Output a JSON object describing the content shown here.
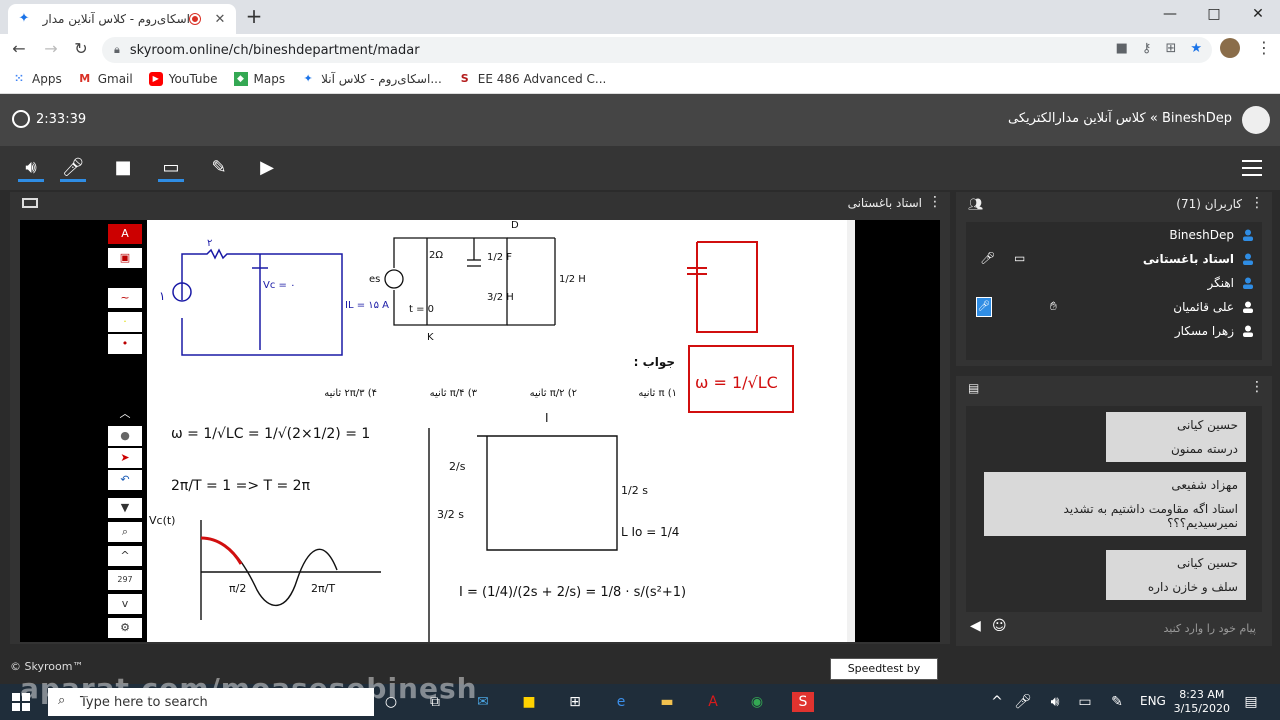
{
  "browser": {
    "tab_title": "اسکای‌روم - کلاس آنلاین مدار ال",
    "new_tab": "+",
    "url": "skyroom.online/ch/bineshdepartment/madar",
    "window_controls": [
      "—",
      "□",
      "✕"
    ]
  },
  "bookmarks": [
    {
      "label": "Apps",
      "icon": "apps-grid-icon"
    },
    {
      "label": "Gmail",
      "icon": "gmail-icon"
    },
    {
      "label": "YouTube",
      "icon": "youtube-icon"
    },
    {
      "label": "Maps",
      "icon": "maps-icon"
    },
    {
      "label": "اسکای‌روم - کلاس آنلا...",
      "icon": "skyroom-icon"
    },
    {
      "label": "EE 486 Advanced C...",
      "icon": "s-logo-icon"
    }
  ],
  "app": {
    "timer": "2:33:39",
    "room_title": "BineshDep » کلاس آنلاین مدارالکتریکی"
  },
  "main_panel": {
    "title": "استاد باغستانی"
  },
  "whiteboard": {
    "answer_label": "جواب :",
    "options": [
      "۱) π ثانیه",
      "۲) π/۲ ثانیه",
      "۳) π/۴ ثانیه",
      "۴) ۲π/۳ ثانیه"
    ],
    "labels": {
      "r2": "۲",
      "src1": "۱",
      "vc": "Vc = ۰",
      "il": "IL = ۱۵ A",
      "d": "D",
      "ohm2": "2Ω",
      "c_half": "1/2 F",
      "l_half": "1/2 H",
      "l_32": "3/2 H",
      "es": "es",
      "t0": "t = 0",
      "k": "K",
      "omega_boxed": "ω = 1/√LC",
      "omega_eq": "ω = 1/√LC = 1/√(2×1/2) = 1",
      "period_eq": "2π/T = 1 => T = 2π",
      "vc_axis": "Vc(t)",
      "pi2": "π/2",
      "t_over_2": "2π/T",
      "i_label": "I",
      "two_s": "2/s",
      "half_s": "1/2 s",
      "three_half_s": "3/2 s",
      "lio": "L Io = 1/4",
      "i_eq": "I = (1/4)/(2s + 2/s) = 1/8 · s/(s²+1)"
    }
  },
  "users": {
    "header": "کاربران (71)",
    "items": [
      {
        "name": "BineshDep",
        "bold": false
      },
      {
        "name": "استاد باغستانی",
        "bold": true
      },
      {
        "name": "اهنگر",
        "bold": false
      },
      {
        "name": "علی قائمیان",
        "bold": false
      },
      {
        "name": "زهرا مسکار",
        "bold": false
      }
    ]
  },
  "chat": {
    "messages": [
      {
        "author": "حسین کیانی",
        "text": "درسته ممنون"
      },
      {
        "author": "مهزاد شفیعی",
        "text": "استاد اگه مقاومت داشتیم به تشدید نمیرسیدیم؟؟؟"
      },
      {
        "author": "حسین کیانی",
        "text": "سلف و خازن داره"
      }
    ],
    "input_placeholder": "پیام خود را وارد کنید"
  },
  "footer": {
    "brand": "© Skyroom™",
    "speedtest": "Speedtest by Ookla"
  },
  "taskbar": {
    "search_placeholder": "Type here to search",
    "lang": "ENG",
    "time": "8:23 AM",
    "date": "3/15/2020",
    "watermark": "aparat.com/moasesebinesh"
  },
  "colors": {
    "accent": "#2f8de4",
    "ink_red": "#d10f0f",
    "ink_blue": "#1a1aa6"
  }
}
